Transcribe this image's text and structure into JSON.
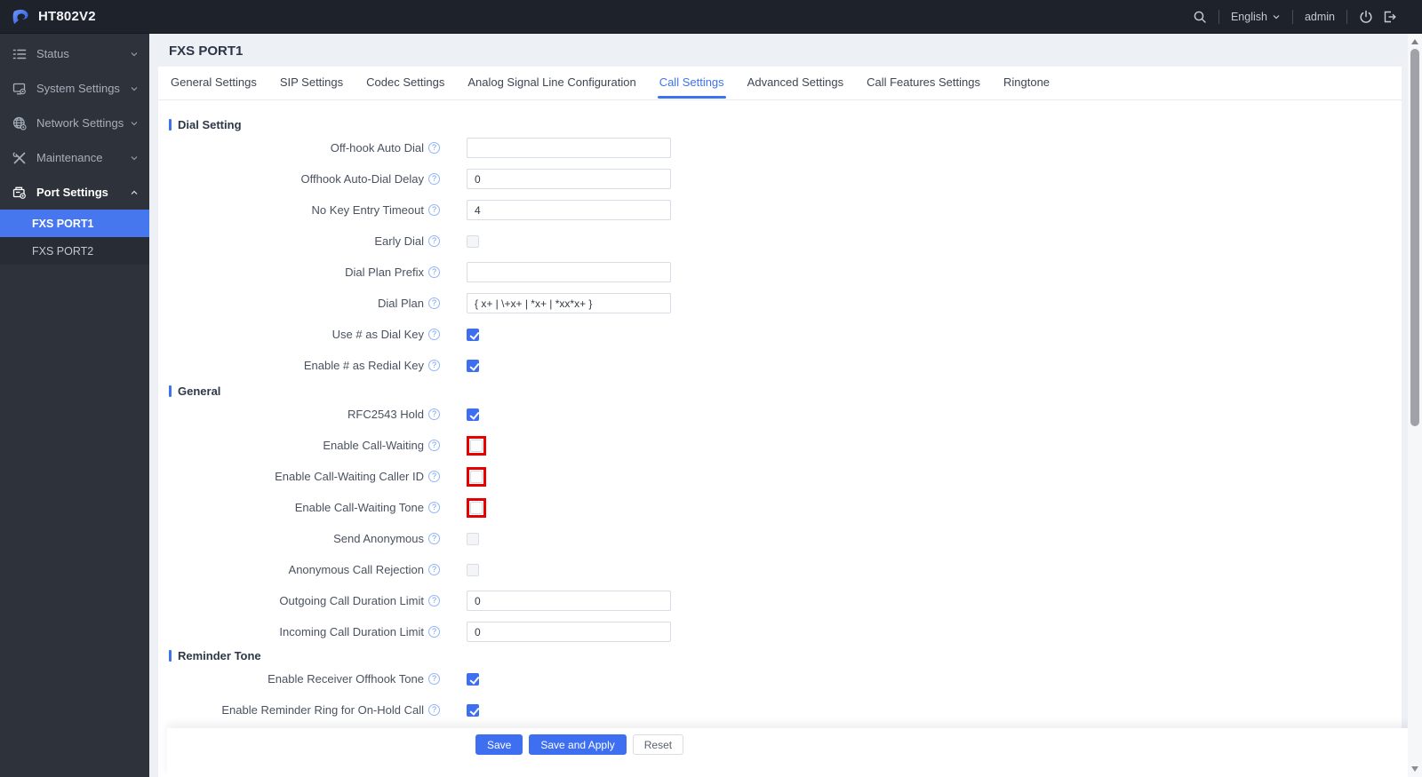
{
  "topbar": {
    "title": "HT802V2",
    "language": "English",
    "user": "admin"
  },
  "sidebar": {
    "items": [
      {
        "label": "Status",
        "icon": "status-icon",
        "expanded": false
      },
      {
        "label": "System Settings",
        "icon": "system-settings-icon",
        "expanded": false
      },
      {
        "label": "Network Settings",
        "icon": "network-settings-icon",
        "expanded": false
      },
      {
        "label": "Maintenance",
        "icon": "maintenance-icon",
        "expanded": false
      },
      {
        "label": "Port Settings",
        "icon": "port-settings-icon",
        "expanded": true,
        "active": true,
        "children": [
          {
            "label": "FXS PORT1",
            "selected": true
          },
          {
            "label": "FXS PORT2",
            "selected": false
          }
        ]
      }
    ]
  },
  "page": {
    "title": "FXS PORT1"
  },
  "tabs": {
    "items": [
      "General Settings",
      "SIP Settings",
      "Codec Settings",
      "Analog Signal Line Configuration",
      "Call Settings",
      "Advanced Settings",
      "Call Features Settings",
      "Ringtone"
    ],
    "active": "Call Settings"
  },
  "form": {
    "sections": [
      {
        "title": "Dial Setting",
        "rows": [
          {
            "label": "Off-hook Auto Dial",
            "type": "text",
            "value": ""
          },
          {
            "label": "Offhook Auto-Dial Delay",
            "type": "text",
            "value": "0"
          },
          {
            "label": "No Key Entry Timeout",
            "type": "text",
            "value": "4"
          },
          {
            "label": "Early Dial",
            "type": "checkbox",
            "checked": false
          },
          {
            "label": "Dial Plan Prefix",
            "type": "text",
            "value": ""
          },
          {
            "label": "Dial Plan",
            "type": "text",
            "value": "{ x+ | \\+x+ | *x+ | *xx*x+ }"
          },
          {
            "label": "Use # as Dial Key",
            "type": "checkbox",
            "checked": true
          },
          {
            "label": "Enable # as Redial Key",
            "type": "checkbox",
            "checked": true
          }
        ]
      },
      {
        "title": "General",
        "rows": [
          {
            "label": "RFC2543 Hold",
            "type": "checkbox",
            "checked": true
          },
          {
            "label": "Enable Call-Waiting",
            "type": "checkbox",
            "checked": false,
            "annotated": true
          },
          {
            "label": "Enable Call-Waiting Caller ID",
            "type": "checkbox",
            "checked": false,
            "annotated": true
          },
          {
            "label": "Enable Call-Waiting Tone",
            "type": "checkbox",
            "checked": false,
            "annotated": true
          },
          {
            "label": "Send Anonymous",
            "type": "checkbox",
            "checked": false
          },
          {
            "label": "Anonymous Call Rejection",
            "type": "checkbox",
            "checked": false
          },
          {
            "label": "Outgoing Call Duration Limit",
            "type": "text",
            "value": "0"
          },
          {
            "label": "Incoming Call Duration Limit",
            "type": "text",
            "value": "0"
          }
        ]
      },
      {
        "title": "Reminder Tone",
        "rows": [
          {
            "label": "Enable Receiver Offhook Tone",
            "type": "checkbox",
            "checked": true
          },
          {
            "label": "Enable Reminder Ring for On-Hold Call",
            "type": "checkbox",
            "checked": true
          }
        ]
      }
    ]
  },
  "footer": {
    "buttons": [
      {
        "label": "Save",
        "style": "primary"
      },
      {
        "label": "Save and Apply",
        "style": "primary"
      },
      {
        "label": "Reset",
        "style": "default"
      }
    ]
  },
  "colors": {
    "accent": "#3e73f0",
    "sidebar_selected": "#4777ee",
    "checkbox_checked": "#3e6ff0",
    "annotation_red": "#e60000",
    "topbar_bg": "#1e222a",
    "sidebar_bg": "#2e323b",
    "content_bg": "#edf0f5"
  }
}
